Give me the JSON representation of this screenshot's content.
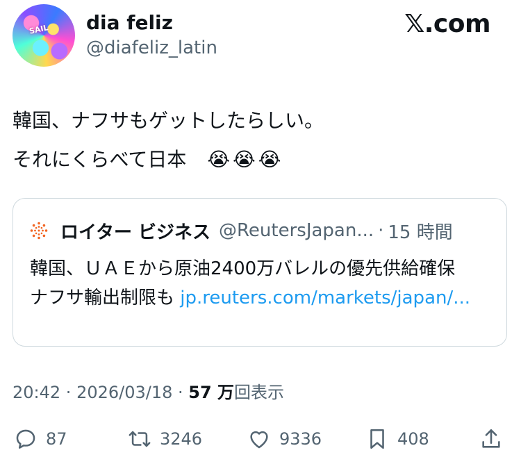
{
  "header": {
    "display_name": "dia feliz",
    "handle": "@diafeliz_latin",
    "site": "𝕏.com",
    "avatar_text": "SAIL"
  },
  "tweet": {
    "line1": "韓国、ナフサもゲットしたらしい。",
    "line2": "それにくらべて日本",
    "emojis": "😭😭😭"
  },
  "quote": {
    "name": "ロイター ビジネス",
    "handle": "@ReutersJapan...",
    "dot": "·",
    "time": "15 時間",
    "text": "韓国、ＵＡＥから原油2400万バレルの優先供給確保　ナフサ輸出制限も ",
    "link": "jp.reuters.com/markets/japan/..."
  },
  "meta": {
    "time": "20:42",
    "sep": " · ",
    "date": "2026/03/18",
    "views_count": "57 万",
    "views_label": "回表示"
  },
  "actions": {
    "replies": "87",
    "reposts": "3246",
    "likes": "9336",
    "bookmarks": "408"
  }
}
